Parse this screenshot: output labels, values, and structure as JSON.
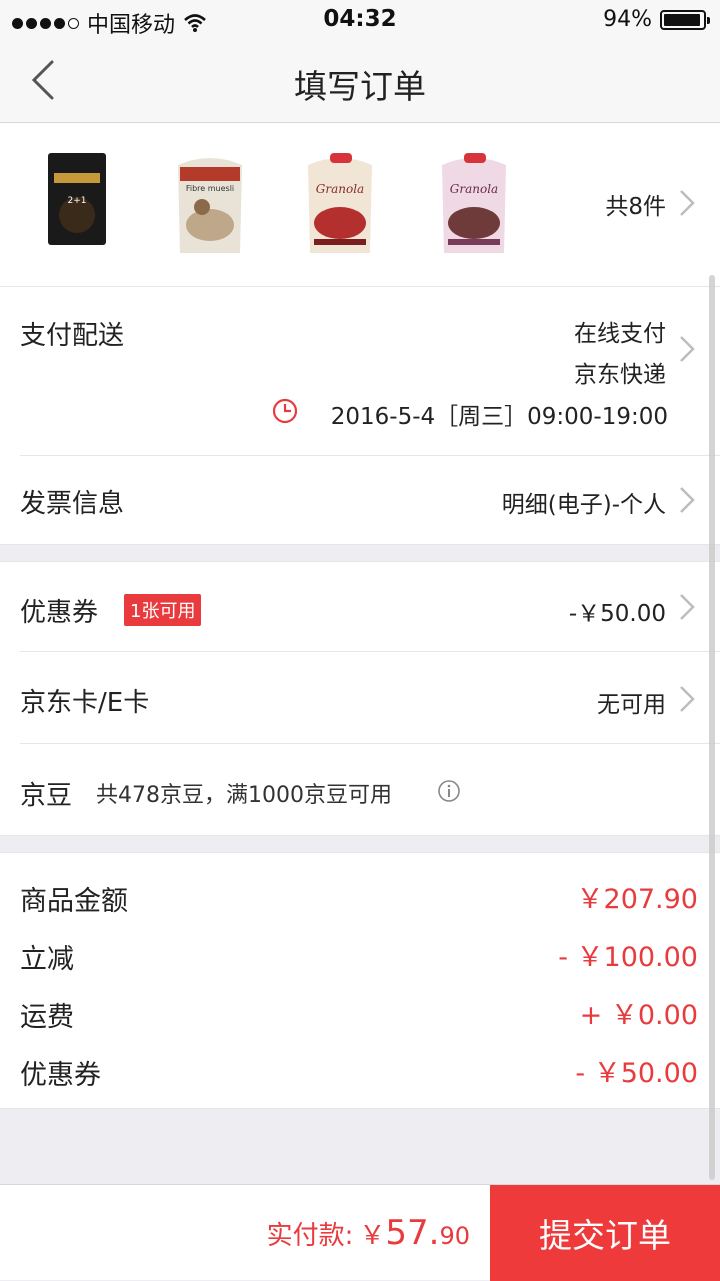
{
  "status": {
    "carrier": "中国移动",
    "time": "04:32",
    "battery": "94%"
  },
  "nav": {
    "title": "填写订单"
  },
  "products": {
    "count": "共8件",
    "items": [
      "Fibre muesli",
      "Granola",
      "Granola"
    ]
  },
  "payment": {
    "label": "支付配送",
    "method": "在线支付",
    "shipping": "京东快递",
    "datetime": "2016-5-4［周三］09:00-19:00"
  },
  "invoice": {
    "label": "发票信息",
    "value": "明细(电子)-个人"
  },
  "coupon": {
    "label": "优惠券",
    "badge": "1张可用",
    "value": "-￥50.00"
  },
  "jdcard": {
    "label": "京东卡/E卡",
    "value": "无可用"
  },
  "jingdou": {
    "label": "京豆",
    "desc": "共478京豆，满1000京豆可用"
  },
  "summary": [
    {
      "label": "商品金额",
      "value": "￥207.90"
    },
    {
      "label": "立减",
      "value": "-  ￥100.00"
    },
    {
      "label": "运费",
      "value": "+  ￥0.00"
    },
    {
      "label": "优惠券",
      "value": "-  ￥50.00"
    }
  ],
  "footer": {
    "pay_label": "实付款:",
    "currency": "￥",
    "amount_int": "57.",
    "amount_dec": "90",
    "submit": "提交订单"
  },
  "colors": {
    "accent": "#e93b3d",
    "submit_bg": "#ef3a3c"
  }
}
